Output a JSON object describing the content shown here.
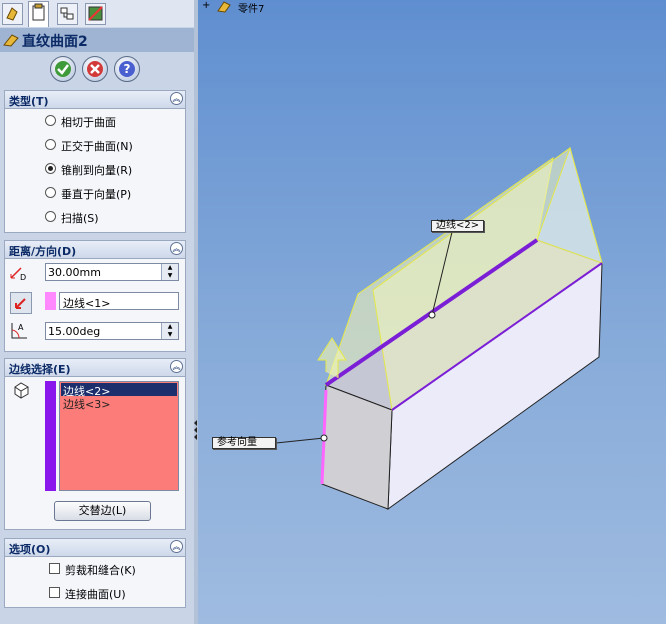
{
  "feature": {
    "title": "直纹曲面2"
  },
  "actions": {
    "ok": "ok",
    "cancel": "cancel",
    "help": "?"
  },
  "type_section": {
    "label": "类型(T)",
    "options": [
      {
        "label": "相切于曲面",
        "selected": false
      },
      {
        "label": "正交于曲面(N)",
        "selected": false
      },
      {
        "label": "锥削到向量(R)",
        "selected": true
      },
      {
        "label": "垂直于向量(P)",
        "selected": false
      },
      {
        "label": "扫描(S)",
        "selected": false
      }
    ]
  },
  "distance_section": {
    "label": "距离/方向(D)",
    "distance_value": "30.00mm",
    "reference_value": "边线<1>",
    "angle_value": "15.00deg"
  },
  "edge_section": {
    "label": "边线选择(E)",
    "edges": [
      "边线<2>",
      "边线<3>"
    ],
    "alternate_button": "交替边(L)"
  },
  "options_section": {
    "label": "选项(O)",
    "options": [
      {
        "label": "剪裁和缝合(K)",
        "checked": false
      },
      {
        "label": "连接曲面(U)",
        "checked": false
      }
    ]
  },
  "viewport": {
    "tree_item": "零件7",
    "callout_edge": "边线<2>",
    "callout_reference": "参考向量"
  },
  "colors": {
    "panel": "#c9d5e7",
    "viewport_top": "#5f8ed0",
    "selected_edge": "#7b1fd6",
    "reference_edge": "#ff66ff",
    "surface": "#f4f7b0"
  }
}
